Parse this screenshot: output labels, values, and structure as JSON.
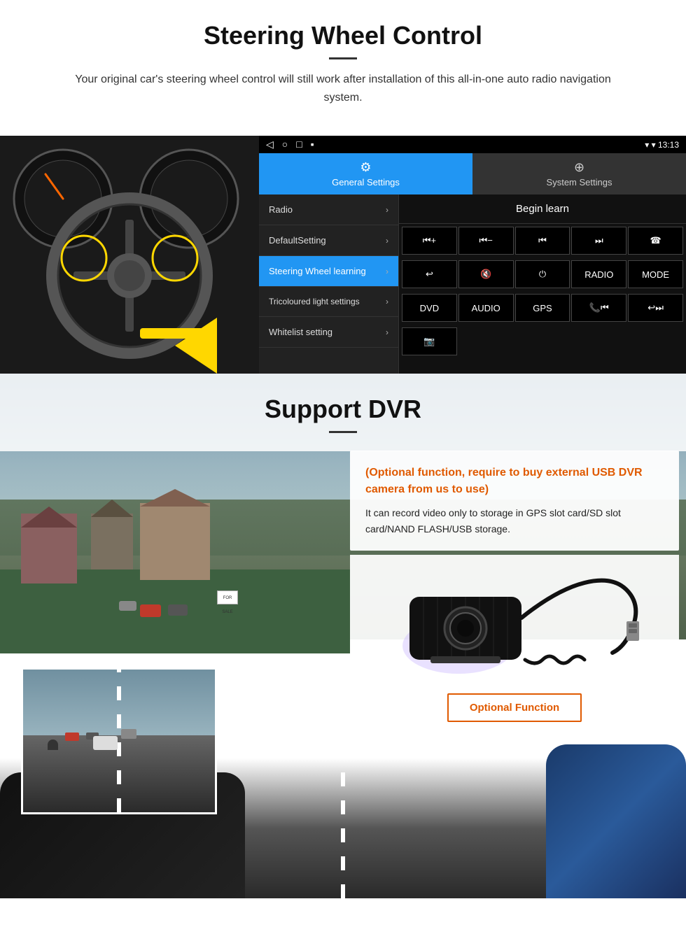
{
  "steering_section": {
    "title": "Steering Wheel Control",
    "subtitle": "Your original car's steering wheel control will still work after installation of this all-in-one auto radio navigation system.",
    "headunit": {
      "statusbar": {
        "time": "13:13",
        "wifi_icon": "▾",
        "signal_icon": "▾"
      },
      "nav_icons": [
        "◁",
        "○",
        "□",
        "▪"
      ],
      "tabs": [
        {
          "label": "General Settings",
          "icon": "⚙",
          "active": true
        },
        {
          "label": "System Settings",
          "icon": "⊕",
          "active": false
        }
      ],
      "menu_items": [
        {
          "label": "Radio",
          "active": false
        },
        {
          "label": "DefaultSetting",
          "active": false
        },
        {
          "label": "Steering Wheel learning",
          "active": true
        },
        {
          "label": "Tricoloured light settings",
          "active": false
        },
        {
          "label": "Whitelist setting",
          "active": false
        }
      ],
      "begin_learn_label": "Begin learn",
      "button_rows": [
        [
          "⏮+",
          "⏮-",
          "⏮",
          "⏭",
          "☎"
        ],
        [
          "↩",
          "🔇x",
          "⏻",
          "RADIO",
          "MODE"
        ],
        [
          "DVD",
          "AUDIO",
          "GPS",
          "📞⏮",
          "↩⏭"
        ],
        [
          "📸"
        ]
      ]
    }
  },
  "dvr_section": {
    "title": "Support DVR",
    "optional_text": "(Optional function, require to buy external USB DVR camera from us to use)",
    "description": "It can record video only to storage in GPS slot card/SD slot card/NAND FLASH/USB storage.",
    "optional_button_label": "Optional Function"
  }
}
